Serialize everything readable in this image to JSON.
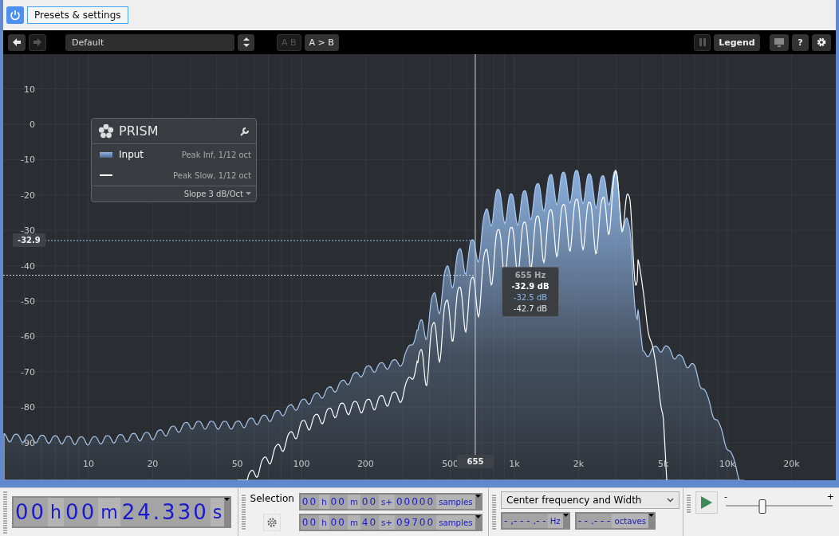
{
  "header": {
    "power_on": true,
    "presets_button": "Presets & settings"
  },
  "toolbar": {
    "preset": "Default",
    "ab_button": "A B",
    "ab_disabled": true,
    "copy_button": "A > B",
    "pause_disabled": true,
    "legend_button": "Legend",
    "help_button": "?"
  },
  "analyzer": {
    "y_axis_labels": [
      "10",
      "0",
      "-10",
      "-20",
      "-30",
      "-40",
      "-50",
      "-60",
      "-70",
      "-80",
      "-90"
    ],
    "x_axis_labels": [
      "10",
      "20",
      "50",
      "100",
      "200",
      "500",
      "1k",
      "2k",
      "5k",
      "10k",
      "20k"
    ],
    "legend": {
      "title": "PRISM",
      "rows": [
        {
          "kind": "area",
          "label": "Input",
          "detail": "Peak Inf, 1/12 oct"
        },
        {
          "kind": "line",
          "detail": "Peak Slow, 1/12 oct"
        }
      ],
      "slope": "Slope 3 dB/Oct"
    },
    "cursor": {
      "value_badge": "-32.9",
      "freq_badge": "655",
      "tooltip": {
        "freq": "655 Hz",
        "readings": [
          {
            "kind": "cursor",
            "text": "-32.9 dB"
          },
          {
            "kind": "input",
            "text": "-32.5 dB"
          },
          {
            "kind": "slow",
            "text": "-42.7 dB"
          }
        ]
      }
    }
  },
  "bottom": {
    "time": [
      {
        "digits": "00",
        "unit": "h"
      },
      {
        "digits": "00",
        "unit": "m"
      },
      {
        "digits": "24.330",
        "unit": "s"
      }
    ],
    "selection": {
      "label": "Selection",
      "fields": [
        [
          {
            "digits": "00",
            "unit": "h"
          },
          {
            "digits": "00",
            "unit": "m"
          },
          {
            "digits": "00",
            "unit": "s+"
          },
          {
            "digits": "00000",
            "unit": "samples"
          }
        ],
        [
          {
            "digits": "00",
            "unit": "h"
          },
          {
            "digits": "00",
            "unit": "m"
          },
          {
            "digits": "40",
            "unit": "s+"
          },
          {
            "digits": "09700",
            "unit": "samples"
          }
        ]
      ]
    },
    "spectral": {
      "mode": "Center frequency and Width",
      "frequency": {
        "digits": "- ,- - - .- -",
        "unit": "Hz"
      },
      "width": {
        "digits": "- - .- - -",
        "unit": "octaves"
      }
    },
    "playback": {
      "minus": "-",
      "plus": "+",
      "level": 0.34
    }
  }
}
